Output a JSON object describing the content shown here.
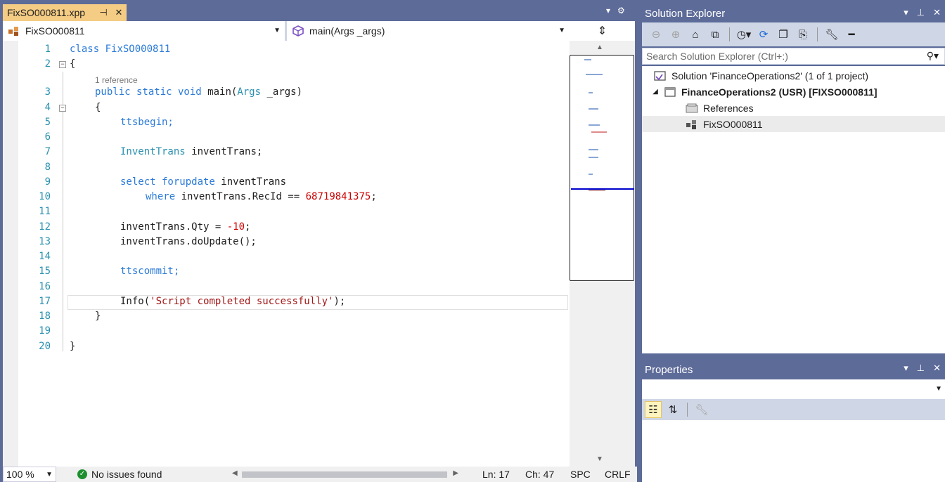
{
  "editor": {
    "tab_title": "FixSO000811.xpp",
    "nav_class": "FixSO000811",
    "nav_method": "main(Args _args)",
    "reference_lens": "1 reference",
    "line_numbers": [
      "1",
      "2",
      "3",
      "4",
      "5",
      "6",
      "7",
      "8",
      "9",
      "10",
      "11",
      "12",
      "13",
      "14",
      "15",
      "16",
      "17",
      "18",
      "19",
      "20"
    ],
    "code": {
      "l1_kw": "class",
      "l1_name": "FixSO000811",
      "l2": "{",
      "l3_kw": "public static void",
      "l3_name": "main(",
      "l3_type": "Args",
      "l3_rest": "_args)",
      "l4": "{",
      "l5": "ttsbegin;",
      "l7_type": "InventTrans",
      "l7_rest": "inventTrans;",
      "l9_kw": "select forupdate",
      "l9_rest": "inventTrans",
      "l10_kw": "where",
      "l10_rest": "inventTrans.RecId ==",
      "l10_num": "68719841375",
      "l10_end": ";",
      "l12_rest": "inventTrans.Qty = ",
      "l12_num": "-10",
      "l12_end": ";",
      "l13": "inventTrans.doUpdate();",
      "l15": "ttscommit;",
      "l17_fn": "Info(",
      "l17_str": "'Script completed successfully'",
      "l17_end": ");",
      "l18": "}",
      "l20": "}"
    }
  },
  "status_bar": {
    "zoom": "100 %",
    "issues": "No issues found",
    "line": "Ln: 17",
    "col": "Ch: 47",
    "spacing": "SPC",
    "line_ending": "CRLF"
  },
  "solution_explorer": {
    "title": "Solution Explorer",
    "search_placeholder": "Search Solution Explorer (Ctrl+:)",
    "tree": [
      {
        "label": "Solution 'FinanceOperations2' (1 of 1 project)"
      },
      {
        "label": "FinanceOperations2 (USR) [FIXSO000811]"
      },
      {
        "label": "References"
      },
      {
        "label": "FixSO000811"
      }
    ]
  },
  "properties": {
    "title": "Properties"
  },
  "colors": {
    "chrome": "#5d6b99",
    "active_tab": "#f5cc84",
    "toolbar": "#cfd6e5",
    "keyword": "#0000ff",
    "type": "#2b91af",
    "number": "#d00000",
    "string": "#a31515"
  }
}
